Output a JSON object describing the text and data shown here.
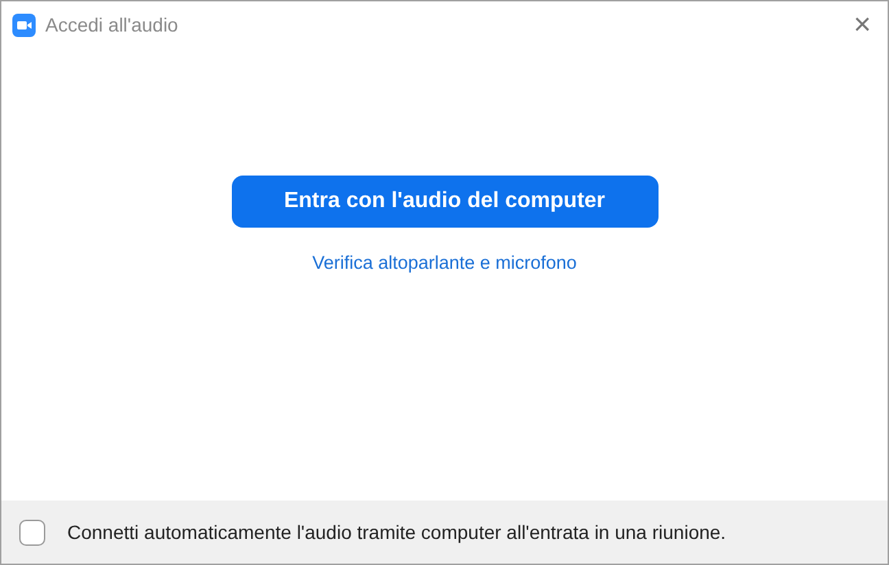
{
  "window": {
    "title": "Accedi all'audio",
    "close": "×"
  },
  "join_button": {
    "label": "Entra con l'audio del computer"
  },
  "test_link": {
    "label": "Verifica altoparlante e microfono"
  },
  "auto_connect": {
    "label": "Connetti automaticamente l'audio tramite computer all'entrata in una riunione.",
    "checked": false
  }
}
